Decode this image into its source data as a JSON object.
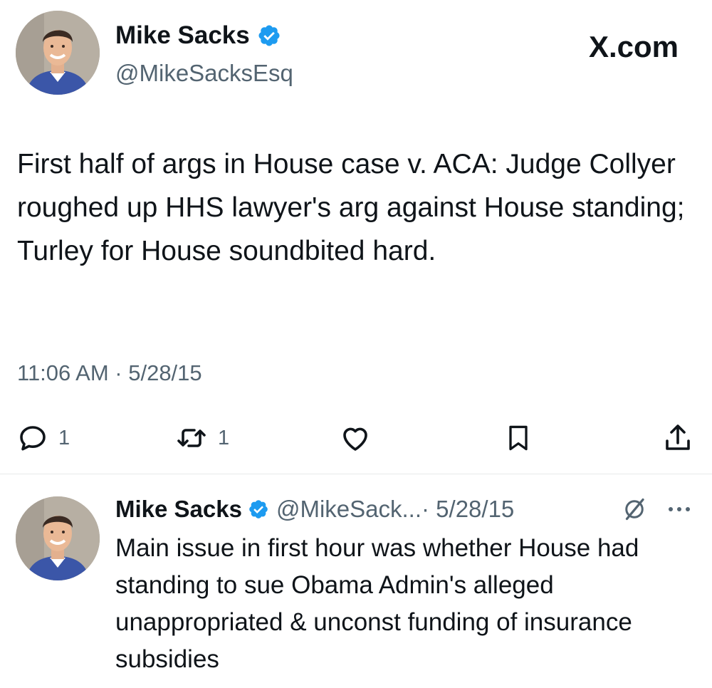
{
  "main_tweet": {
    "author": {
      "display_name": "Mike Sacks",
      "handle": "@MikeSacksEsq",
      "verified": true
    },
    "brand": "X.com",
    "text": "First half of args in House case v. ACA: Judge Collyer roughed up HHS lawyer's arg against House standing; Turley for House soundbited hard.",
    "timestamp": "11:06 AM · 5/28/15",
    "actions": {
      "reply_count": "1",
      "retweet_count": "1"
    }
  },
  "reply_tweet": {
    "author": {
      "display_name": "Mike Sacks",
      "handle": "@MikeSack...",
      "verified": true
    },
    "date": " · 5/28/15",
    "text": "Main issue in first hour was whether House had standing to sue Obama Admin's alleged unappropriated & unconst funding of insurance subsidies"
  },
  "colors": {
    "verified_blue": "#1d9bf0",
    "secondary_text": "#536471",
    "primary_text": "#0f1419",
    "divider": "#e7e9ea"
  },
  "icons": [
    "verified-badge-icon",
    "reply-icon",
    "retweet-icon",
    "like-icon",
    "bookmark-icon",
    "share-icon",
    "grok-icon",
    "more-icon"
  ]
}
